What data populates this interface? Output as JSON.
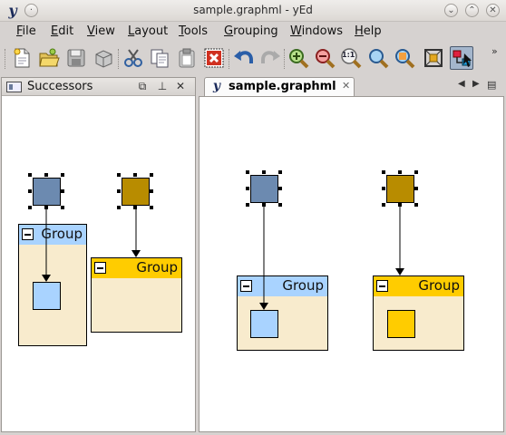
{
  "window": {
    "title": "sample.graphml - yEd",
    "app_icon_letter": "y"
  },
  "menu": [
    {
      "label": "File",
      "accel": "F",
      "rest": "ile"
    },
    {
      "label": "Edit",
      "accel": "E",
      "rest": "dit"
    },
    {
      "label": "View",
      "accel": "V",
      "rest": "iew"
    },
    {
      "label": "Layout",
      "accel": "L",
      "rest": "ayout"
    },
    {
      "label": "Tools",
      "accel": "T",
      "rest": "ools"
    },
    {
      "label": "Grouping",
      "accel": "G",
      "rest": "rouping"
    },
    {
      "label": "Windows",
      "accel": "W",
      "rest": "indows"
    },
    {
      "label": "Help",
      "accel": "H",
      "rest": "elp"
    }
  ],
  "toolbar": {
    "buttons": [
      {
        "name": "new-document-icon"
      },
      {
        "name": "open-folder-icon"
      },
      {
        "name": "save-icon"
      },
      {
        "name": "save-all-icon"
      },
      {
        "name": "cut-icon"
      },
      {
        "name": "copy-icon"
      },
      {
        "name": "paste-icon"
      },
      {
        "name": "delete-icon"
      },
      {
        "name": "undo-icon"
      },
      {
        "name": "redo-icon"
      },
      {
        "name": "zoom-in-icon"
      },
      {
        "name": "zoom-out-icon"
      },
      {
        "name": "zoom-original-icon",
        "label": "1:1"
      },
      {
        "name": "zoom-fit-icon"
      },
      {
        "name": "zoom-selection-icon"
      },
      {
        "name": "fit-content-icon"
      },
      {
        "name": "edit-mode-icon",
        "active": true
      }
    ],
    "overflow": "»"
  },
  "successors_panel": {
    "title": "Successors",
    "controls": [
      "restore-icon",
      "pin-icon",
      "close-icon"
    ]
  },
  "document_tab": {
    "label": "sample.graphml",
    "close": "✕",
    "nav_prev": "◀",
    "nav_next": "▶",
    "menu": "▤"
  },
  "group_label": "Group",
  "colors": {
    "node_blue": "#6c8ab0",
    "node_gold": "#b88c00",
    "child_lightblue": "#a9d3ff",
    "child_yellow": "#ffcc00",
    "group_fill": "#f8ebcd",
    "group_header_blue": "#a9d3ff",
    "group_header_yellow": "#ffcc00"
  }
}
